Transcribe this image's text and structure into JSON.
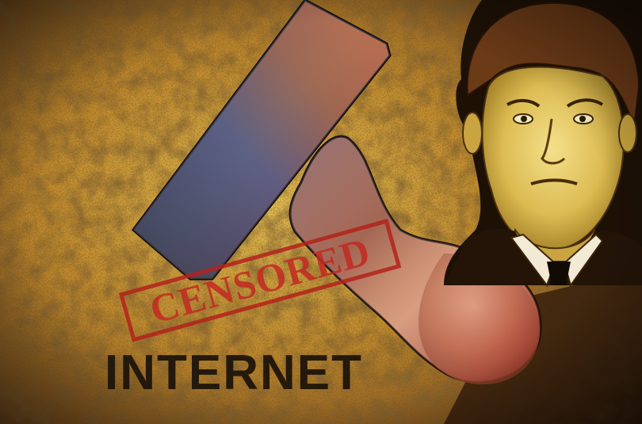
{
  "stamp_text": "CENSORED",
  "caption": "INTERNET",
  "colors": {
    "parchment": "#c9962e",
    "stamp_red": "#b3231c",
    "ink_black": "#1a1209"
  }
}
